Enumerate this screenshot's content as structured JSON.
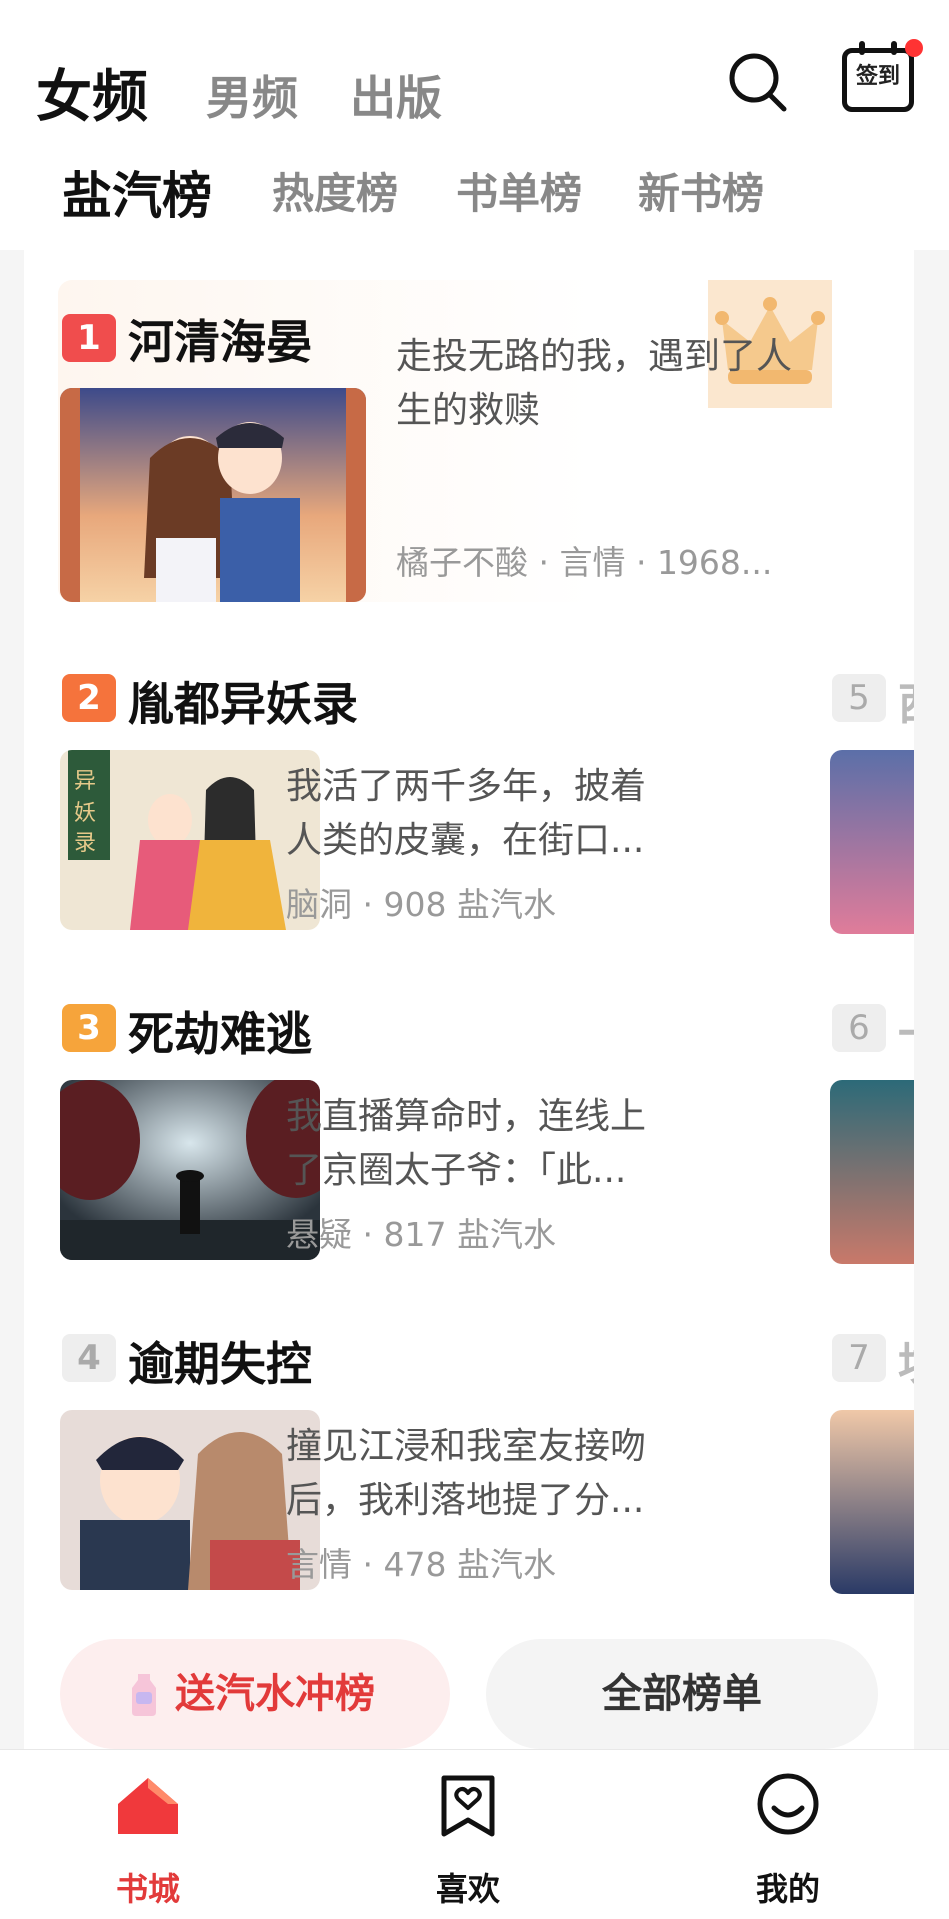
{
  "header": {
    "tabs": [
      "女频",
      "男频",
      "出版"
    ],
    "checkin_label": "签到"
  },
  "subtabs": [
    "盐汽榜",
    "热度榜",
    "书单榜",
    "新书榜"
  ],
  "ranking": [
    {
      "rank": "1",
      "title": "河清海晏",
      "desc_line1": "走投无路的我，遇到了人",
      "desc_line2": "生的救赎",
      "meta": "橘子不酸 · 言情 · 1968...",
      "rank_color": "#f04d4d"
    },
    {
      "rank": "2",
      "title": "胤都异妖录",
      "desc_line1": "我活了两千多年，披着",
      "desc_line2": "人类的皮囊，在街口...",
      "meta": "脑洞 · 908 盐汽水",
      "rank_color": "#f5733c"
    },
    {
      "rank": "3",
      "title": "死劫难逃",
      "desc_line1": "我直播算命时，连线上",
      "desc_line2": "了京圈太子爷：「此...",
      "meta": "悬疑 · 817 盐汽水",
      "rank_color": "#f6a43b"
    },
    {
      "rank": "4",
      "title": "逾期失控",
      "desc_line1": "撞见江浸和我室友接吻",
      "desc_line2": "后，我利落地提了分...",
      "meta": "言情 · 478 盐汽水",
      "rank_color": "#eeeeee"
    }
  ],
  "peek": [
    {
      "rank": "5",
      "char": "西"
    },
    {
      "rank": "6",
      "char": "一"
    },
    {
      "rank": "7",
      "char": "坟"
    }
  ],
  "buttons": {
    "rush": "送汽水冲榜",
    "all": "全部榜单"
  },
  "bottom_nav": [
    {
      "label": "书城",
      "icon": "home-icon",
      "active": true
    },
    {
      "label": "喜欢",
      "icon": "bookmark-heart-icon",
      "active": false
    },
    {
      "label": "我的",
      "icon": "smile-icon",
      "active": false
    }
  ],
  "colors": {
    "accent": "#e23a3a",
    "active_nav": "#e23a3a"
  }
}
